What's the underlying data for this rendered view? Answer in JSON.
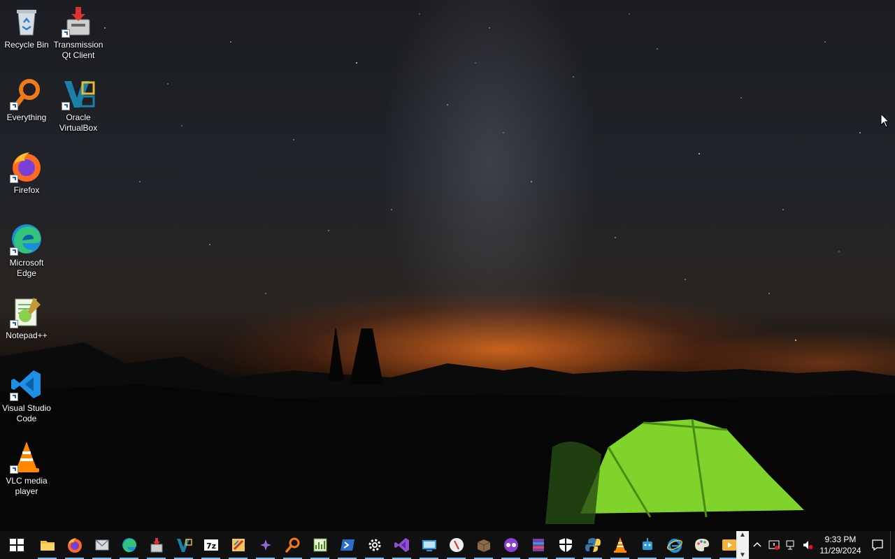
{
  "desktop": {
    "icons": [
      {
        "label": "Recycle Bin",
        "icon": "recycle-bin-icon"
      },
      {
        "label": "Transmission Qt Client",
        "icon": "transmission-icon"
      },
      {
        "label": "Everything",
        "icon": "everything-search-icon"
      },
      {
        "label": "Oracle VirtualBox",
        "icon": "virtualbox-icon"
      },
      {
        "label": "Firefox",
        "icon": "firefox-icon"
      },
      {
        "label": "Microsoft Edge",
        "icon": "edge-icon"
      },
      {
        "label": "Notepad++",
        "icon": "notepadpp-icon"
      },
      {
        "label": "Visual Studio Code",
        "icon": "vscode-icon"
      },
      {
        "label": "VLC media player",
        "icon": "vlc-icon"
      }
    ]
  },
  "taskbar": {
    "apps": [
      "file-explorer-icon",
      "firefox-icon",
      "mail-icon",
      "edge-icon",
      "transmission-icon",
      "virtualbox-icon",
      "7zip-icon",
      "paint-icon",
      "sparkle-icon",
      "everything-search-icon",
      "chart-app-icon",
      "powershell-icon",
      "settings-gear-icon",
      "visual-studio-icon",
      "remote-desktop-icon",
      "compass-icon",
      "package-icon",
      "glasses-icon",
      "archive-icon",
      "shield-icon",
      "python-icon",
      "vlc-icon",
      "robot-icon",
      "internet-explorer-icon",
      "paint-palette-icon",
      "media-player-icon"
    ],
    "clock": {
      "time": "9:33 PM",
      "date": "11/29/2024"
    }
  },
  "colors": {
    "taskbar": "#101010",
    "accent": "#76b9ed"
  }
}
